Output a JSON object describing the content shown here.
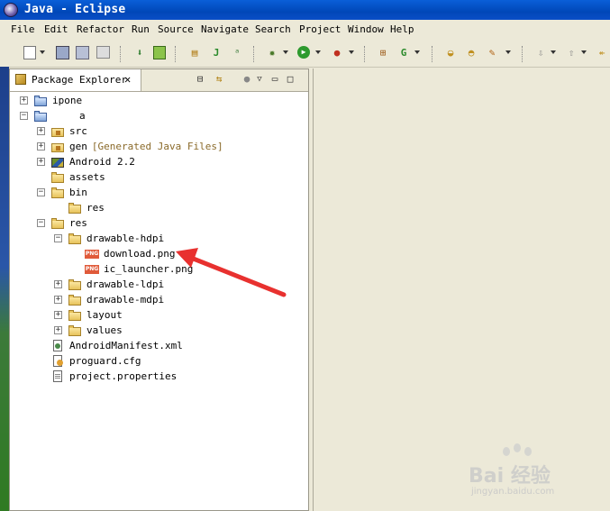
{
  "window": {
    "title": "Java - Eclipse"
  },
  "menu": [
    "File",
    "Edit",
    "Refactor",
    "Run",
    "Source",
    "Navigate",
    "Search",
    "Project",
    "Window",
    "Help"
  ],
  "package_explorer": {
    "tab_label": "Package Explorer",
    "tree": [
      {
        "label": "ipone",
        "icon": "project-icon",
        "toggle": "+"
      },
      {
        "label": "a",
        "icon": "project-icon",
        "toggle": "-"
      },
      {
        "label": "src",
        "icon": "package-folder-icon",
        "toggle": "+"
      },
      {
        "label": "gen",
        "decoration": "[Generated Java Files]",
        "icon": "package-folder-icon",
        "toggle": "+"
      },
      {
        "label": "Android 2.2",
        "icon": "library-icon",
        "toggle": "+"
      },
      {
        "label": "assets",
        "icon": "folder-icon",
        "toggle": ""
      },
      {
        "label": "bin",
        "icon": "folder-icon",
        "toggle": "-"
      },
      {
        "label": "res",
        "icon": "folder-icon",
        "toggle": ""
      },
      {
        "label": "res",
        "icon": "folder-icon",
        "toggle": "-"
      },
      {
        "label": "drawable-hdpi",
        "icon": "folder-icon",
        "toggle": "-"
      },
      {
        "label": "download.png",
        "icon": "png-file-icon",
        "toggle": ""
      },
      {
        "label": "ic_launcher.png",
        "icon": "png-file-icon",
        "toggle": ""
      },
      {
        "label": "drawable-ldpi",
        "icon": "folder-icon",
        "toggle": "+"
      },
      {
        "label": "drawable-mdpi",
        "icon": "folder-icon",
        "toggle": "+"
      },
      {
        "label": "layout",
        "icon": "folder-icon",
        "toggle": "+"
      },
      {
        "label": "values",
        "icon": "folder-icon",
        "toggle": "+"
      },
      {
        "label": "AndroidManifest.xml",
        "icon": "xml-file-icon",
        "toggle": ""
      },
      {
        "label": "proguard.cfg",
        "icon": "config-file-icon",
        "toggle": ""
      },
      {
        "label": "project.properties",
        "icon": "text-file-icon",
        "toggle": ""
      }
    ]
  },
  "watermark": {
    "brand": "Bai 经验",
    "sub": "jingyan.baidu.com"
  },
  "colors": {
    "title_bar": "#0047b8",
    "arrow": "#e8312f",
    "decoration": "#8a6a2a"
  }
}
